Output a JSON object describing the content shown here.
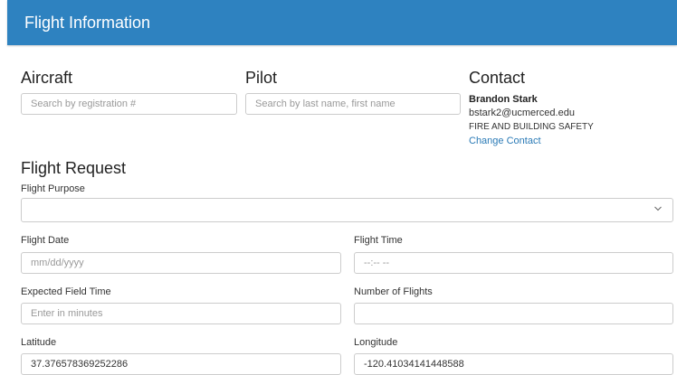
{
  "header": {
    "title": "Flight Information"
  },
  "aircraft": {
    "title": "Aircraft",
    "search_placeholder": "Search by registration #"
  },
  "pilot": {
    "title": "Pilot",
    "search_placeholder": "Search by last name, first name"
  },
  "contact": {
    "title": "Contact",
    "name": "Brandon Stark",
    "email": "bstark2@ucmerced.edu",
    "department": "FIRE AND BUILDING SAFETY",
    "change_link": "Change Contact"
  },
  "flight_request": {
    "title": "Flight Request",
    "purpose": {
      "label": "Flight Purpose",
      "value": ""
    },
    "date": {
      "label": "Flight Date",
      "placeholder": "mm/dd/yyyy"
    },
    "time": {
      "label": "Flight Time",
      "placeholder": "--:-- --"
    },
    "field_time": {
      "label": "Expected Field Time",
      "placeholder": "Enter in minutes"
    },
    "num_flights": {
      "label": "Number of Flights",
      "value": ""
    },
    "latitude": {
      "label": "Latitude",
      "value": "37.376578369252286"
    },
    "longitude": {
      "label": "Longitude",
      "value": "-120.41034141448588"
    }
  },
  "icons": {
    "purpose_dropdown": "chevron-down-icon"
  },
  "colors": {
    "header_bg": "#2e82c0",
    "link": "#2a7ab6"
  }
}
